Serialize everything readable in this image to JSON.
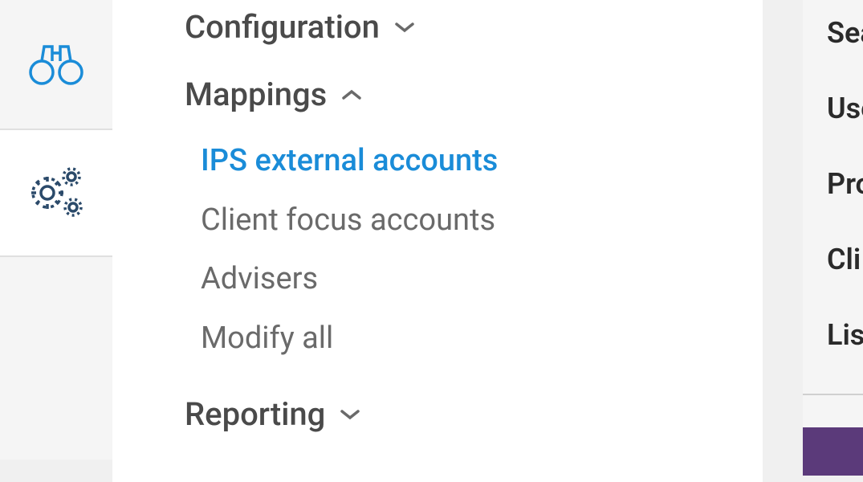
{
  "iconRail": {
    "items": [
      {
        "name": "binoculars-icon",
        "active": false
      },
      {
        "name": "gears-icon",
        "active": true
      }
    ]
  },
  "nav": {
    "sections": [
      {
        "label": "Configuration",
        "expanded": false
      },
      {
        "label": "Mappings",
        "expanded": true,
        "items": [
          {
            "label": "IPS external accounts",
            "selected": true
          },
          {
            "label": "Client focus accounts",
            "selected": false
          },
          {
            "label": "Advisers",
            "selected": false
          },
          {
            "label": "Modify all",
            "selected": false
          }
        ]
      },
      {
        "label": "Reporting",
        "expanded": false
      }
    ]
  },
  "rightPanel": {
    "items": [
      {
        "label": "Sea"
      },
      {
        "label": "Use"
      },
      {
        "label": "Pro"
      },
      {
        "label": "Cli"
      },
      {
        "label": "Lis"
      }
    ]
  },
  "colors": {
    "accent": "#1a8cd8",
    "railIcon": "#2b6ea8",
    "text": "#4a4a4a"
  }
}
